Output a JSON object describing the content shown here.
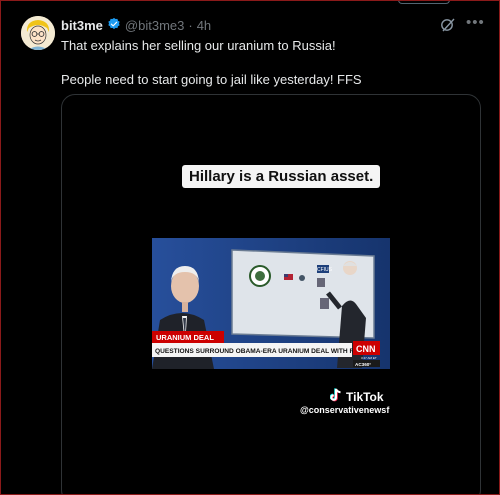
{
  "post": {
    "author_name": "bit3me",
    "handle": "@bit3me3",
    "separator": "·",
    "time": "4h",
    "text_line1": "That explains her selling our uranium to Russia!",
    "text_line2": "People need to start going to jail like yesterday! FFS"
  },
  "media": {
    "caption": "Hillary is a Russian asset.",
    "video": {
      "lower_third_tag": "URANIUM DEAL",
      "lower_third_headline": "QUESTIONS SURROUND OBAMA-ERA URANIUM DEAL WITH RUSSIA",
      "network_logo": "CNN",
      "clock": "3:47 AM ET",
      "show_tag": "AC360°",
      "screen_label": "CFIUS"
    },
    "watermark": {
      "brand": "TikTok",
      "account": "@conservativenewsf"
    }
  },
  "icons": {
    "verified": "verified-badge-icon",
    "grok": "grok-icon",
    "more": "more-options-icon",
    "tiktok": "tiktok-logo-icon"
  },
  "colors": {
    "background": "#000000",
    "verified_blue": "#1d9bf0",
    "muted_text": "#71767b",
    "cnn_red": "#cc0000"
  }
}
